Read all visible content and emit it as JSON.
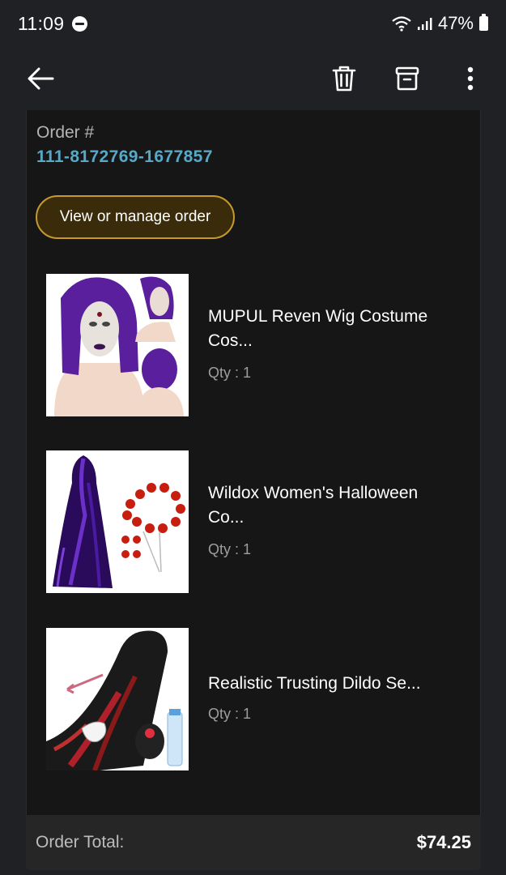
{
  "status_bar": {
    "time": "11:09",
    "battery": "47%",
    "icons": [
      "do-not-disturb-icon",
      "wifi-icon",
      "signal-icon",
      "battery-icon"
    ]
  },
  "app_bar": {
    "icons": [
      "back-arrow-icon",
      "trash-icon",
      "archive-icon",
      "more-vert-icon"
    ]
  },
  "order": {
    "label": "Order #",
    "number": "111-8172769-1677857",
    "manage_label": "View or manage order"
  },
  "items": [
    {
      "title": "MUPUL Reven Wig Costume Cos...",
      "qty": "Qty : 1"
    },
    {
      "title": "Wildox Women's Halloween Co...",
      "qty": "Qty : 1"
    },
    {
      "title": "Realistic Trusting Dildo Se...",
      "qty": "Qty : 1"
    }
  ],
  "total": {
    "label": "Order Total:",
    "value": "$74.25"
  },
  "colors": {
    "background": "#202124",
    "card": "#161616",
    "accent_link": "#58a8c8",
    "button_border": "#c79a2e",
    "button_fill": "#3a2c0a"
  }
}
